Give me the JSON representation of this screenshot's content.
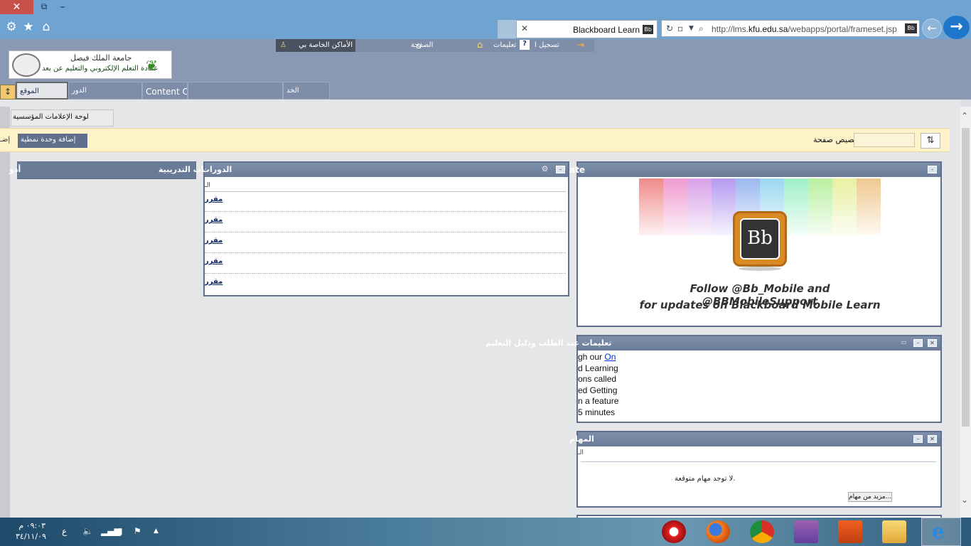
{
  "browser": {
    "tab_title": "Blackboard Learn",
    "tab_favicon": "Bb",
    "url_plain": "http://lms.",
    "url_host": "kfu.edu.sa",
    "url_path": "/webapps/portal/frameset.jsp",
    "addr_favicon": "Bb",
    "icons": [
      "gear-icon",
      "star-icon",
      "home-icon",
      "refresh-icon",
      "search-icon",
      "back-arrow-icon",
      "forward-arrow-icon"
    ]
  },
  "topnav": {
    "my_places": "الأماكن الخاصة بي",
    "page": "الصفحة",
    "help": "تعليمات",
    "logout": "تسجيل ا"
  },
  "logo": {
    "line1": "جامعة الملك فيصل",
    "line2": "عمادة التعلم الإلكتروني والتعليم عن بعد"
  },
  "tabs": {
    "t1": "الموقع",
    "t2": "الدور",
    "t3": "Content Collection",
    "t4": "الخد"
  },
  "subtab": "لوحة الإعلامات المؤسسية",
  "action_bar": {
    "add_button": "إضافة وحدة نمطية",
    "left_cut": "إضـ",
    "customize_label": "تخصيص صفحة"
  },
  "left_column": {
    "title_cut": "أدو",
    "title": "الدورات التدريبية"
  },
  "courses_module": {
    "title": "الدورات",
    "sub": "الـ",
    "rows": [
      "مقرر",
      "مقرر",
      "مقرر",
      "مقرر",
      "مقرر"
    ]
  },
  "mobile_module": {
    "title": "ate",
    "caption1": "Follow @Bb_Mobile and @BBMobileSupport",
    "caption2": "for updates on Blackboard Mobile Learn",
    "tile_text": "Bb"
  },
  "tips_module": {
    "title": "تعليمات عند الطلب ودليل التعليم",
    "line1_pre": "gh our ",
    "line1_link": "On",
    "line2": "d Learning",
    "line3": "ons called",
    "line4": "ed Getting",
    "line5": "n a feature",
    "line6": "5 minutes"
  },
  "tasks_module": {
    "title": "المهام",
    "sub": "الـ",
    "none": "لا توجد مهام متوقعة.",
    "more_button": "مزيد من مهام..."
  },
  "taskbar": {
    "time": "٠٩:٠٣ م",
    "date": "٣٤/١١/٠٩",
    "lang": "ع",
    "apps": [
      "opera-icon",
      "firefox-icon",
      "chrome-icon",
      "winrar-icon",
      "office-icon",
      "folder-icon",
      "ie-icon"
    ]
  },
  "colors": {
    "chrome": "#6fa3d2",
    "bb_header": "#8a99b3",
    "module_header": "#6a7b98",
    "action_bar": "#fdf2c8"
  }
}
